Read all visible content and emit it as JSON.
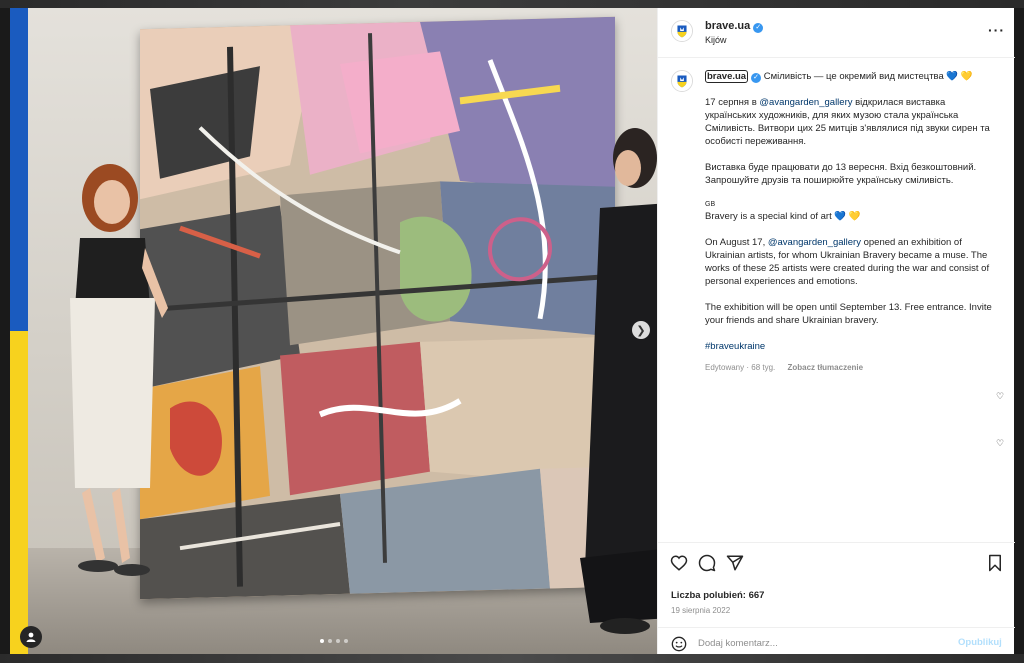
{
  "post": {
    "username": "brave.ua",
    "location": "Kijów",
    "more_icon": "more-horizontal-icon",
    "verified_icon": "verified-badge-icon"
  },
  "caption": {
    "username": "brave.ua",
    "headline_ua": "Сміливість — це окремий вид мистецтва 💙 💛",
    "para1_prefix": "17 серпня в ",
    "para1_link": "@avangarden_gallery",
    "para1_suffix": " відкрилася виставка українських художників, для яких музою стала українська Сміливість. Витвори цих 25 митців з'являлися під звуки сирен та особисті переживання.",
    "para2": "Виставка буде працювати до 13 вересня. Вхід безкоштовний. Запрошуйте друзів та поширюйте українську сміливість.",
    "lang_tag": "GB",
    "headline_en": "Bravery is a special kind of art 💙 💛",
    "para3_prefix": "On August 17, ",
    "para3_link": "@avangarden_gallery",
    "para3_suffix": " opened an exhibition of Ukrainian artists, for whom Ukrainian Bravery became a muse. The works of these 25 artists were created during the war and consist of personal experiences and emotions.",
    "para4": "The exhibition will be open until September 13. Free entrance. Invite your friends and share Ukrainian bravery.",
    "hashtag": "#braveukraine",
    "meta": "Edytowany · 68 tyg.",
    "translate": "Zobacz tłumaczenie"
  },
  "actions": {
    "like_icon": "heart-icon",
    "comment_icon": "comment-icon",
    "share_icon": "send-icon",
    "save_icon": "bookmark-icon",
    "likes": "Liczba polubień: 667",
    "date": "19 sierpnia 2022"
  },
  "comment": {
    "placeholder": "Dodaj komentarz...",
    "publish": "Opublikuj",
    "emoji_icon": "emoji-icon"
  },
  "media": {
    "next_icon": "chevron-right-icon",
    "tag_icon": "user-tag-icon",
    "carousel_count": 4,
    "carousel_active": 1
  },
  "colors": {
    "flag_blue": "#1a5bbf",
    "flag_yellow": "#f7d21e",
    "verified": "#3897f0",
    "link": "#00376b",
    "publish_disabled": "#b2dffc"
  }
}
